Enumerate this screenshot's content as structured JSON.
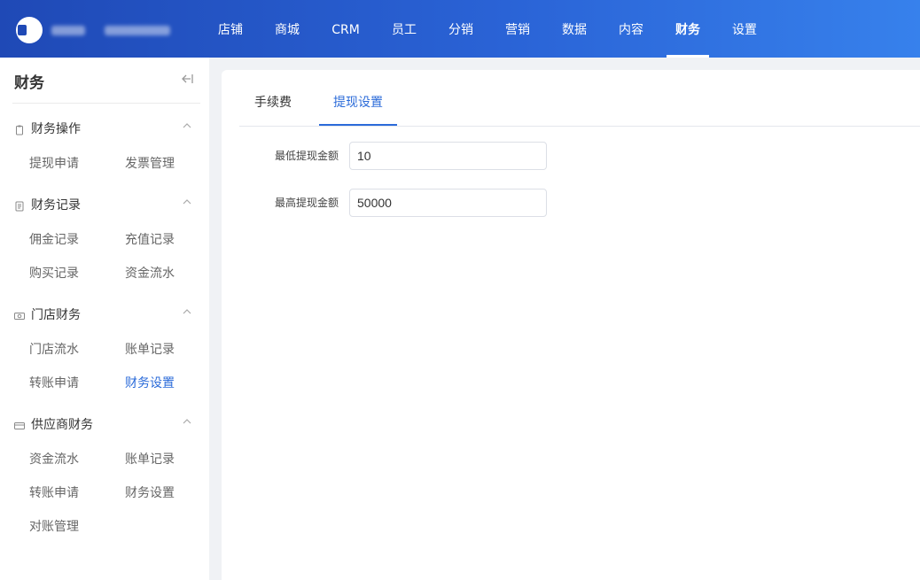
{
  "header": {
    "nav": [
      {
        "label": "店铺"
      },
      {
        "label": "商城"
      },
      {
        "label": "CRM"
      },
      {
        "label": "员工"
      },
      {
        "label": "分销"
      },
      {
        "label": "营销"
      },
      {
        "label": "数据"
      },
      {
        "label": "内容"
      },
      {
        "label": "财务"
      },
      {
        "label": "设置"
      }
    ],
    "active_nav": "财务"
  },
  "sidebar": {
    "title": "财务",
    "groups": [
      {
        "label": "财务操作",
        "icon": "clipboard-icon",
        "items": [
          "提现申请",
          "发票管理"
        ]
      },
      {
        "label": "财务记录",
        "icon": "document-icon",
        "items": [
          "佣金记录",
          "充值记录",
          "购买记录",
          "资金流水"
        ]
      },
      {
        "label": "门店财务",
        "icon": "cash-icon",
        "items": [
          "门店流水",
          "账单记录",
          "转账申请",
          "财务设置"
        ]
      },
      {
        "label": "供应商财务",
        "icon": "card-icon",
        "items": [
          "资金流水",
          "账单记录",
          "转账申请",
          "财务设置",
          "对账管理"
        ]
      }
    ],
    "active_item": "财务设置"
  },
  "main": {
    "tabs": [
      {
        "label": "手续费"
      },
      {
        "label": "提现设置"
      }
    ],
    "active_tab": "提现设置",
    "form": {
      "min_label": "最低提现金额",
      "min_value": "10",
      "max_label": "最高提现金额",
      "max_value": "50000"
    }
  },
  "colors": {
    "header_start": "#1f49b6",
    "header_end": "#3781ec",
    "accent": "#2b6bd9"
  }
}
